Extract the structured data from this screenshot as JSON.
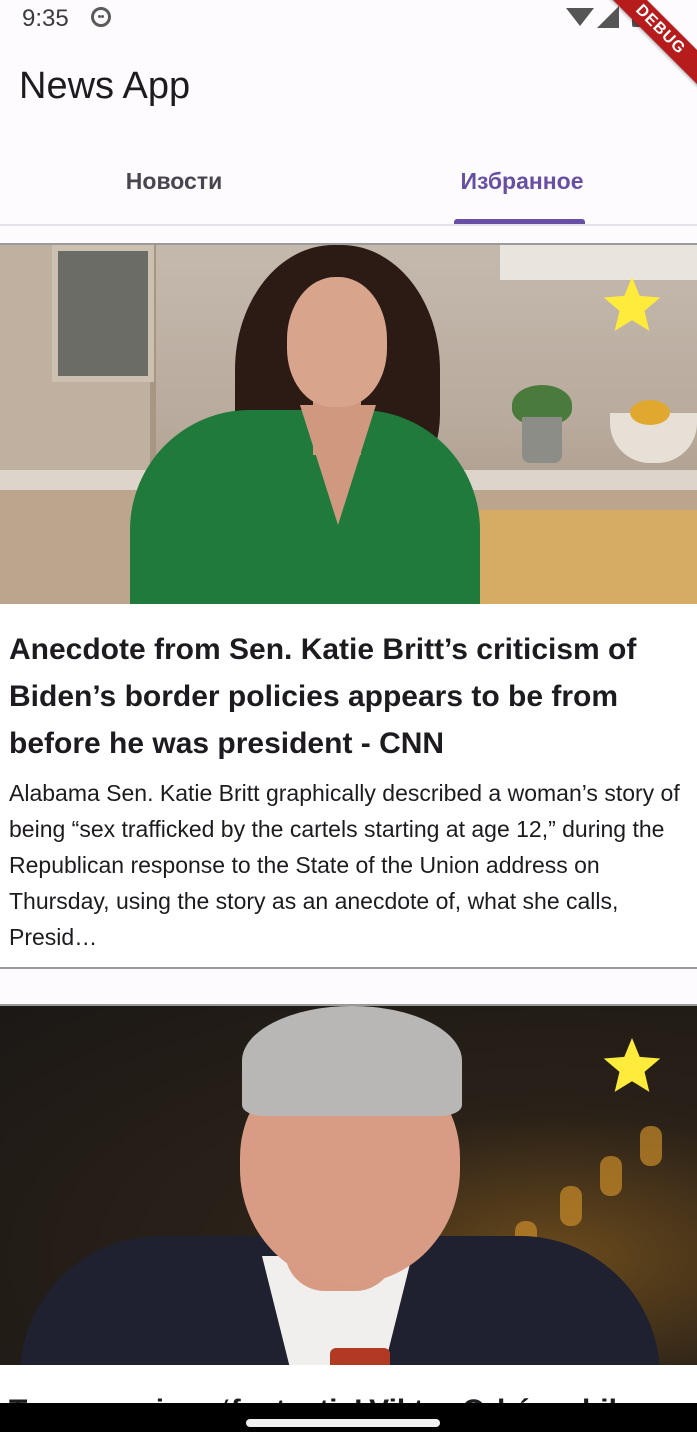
{
  "status_bar": {
    "time": "9:35",
    "icons": [
      "face-icon",
      "wifi-icon",
      "signal-icon",
      "battery-icon"
    ]
  },
  "debug_banner": "DEBUG",
  "app_bar": {
    "title": "News App"
  },
  "tabs": [
    {
      "label": "Новости",
      "selected": false
    },
    {
      "label": "Избранное",
      "selected": true
    }
  ],
  "colors": {
    "accent": "#6750a4",
    "star": "#ffeb3b",
    "background": "#fefbff"
  },
  "articles": [
    {
      "title": "Anecdote from Sen. Katie Britt’s criticism of Biden’s border policies appears to be from before he was president - CNN",
      "description": "Alabama Sen. Katie Britt graphically described a woman’s story of being “sex trafficked by the cartels starting at age 12,” during the Republican response to the State of the Union address on Thursday, using the story as an anecdote of, what she calls, Presid…",
      "favorite": true
    },
    {
      "title": "Trump praises ‘fantastic’ Viktor Orbán while",
      "description": "",
      "favorite": true
    }
  ]
}
